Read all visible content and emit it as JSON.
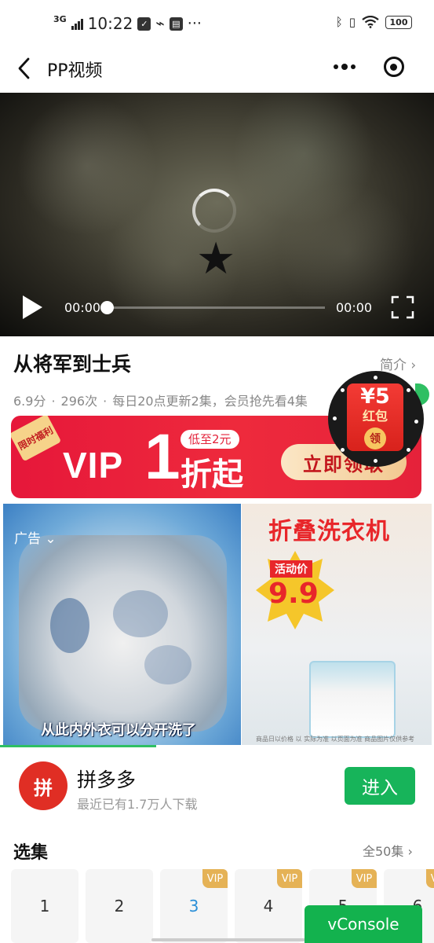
{
  "status_bar": {
    "network": "3G",
    "time": "10:22",
    "battery": "100",
    "more": "···"
  },
  "nav": {
    "title": "PP视频"
  },
  "player": {
    "current_time": "00:00",
    "duration": "00:00",
    "progress": 0
  },
  "video": {
    "title": "从将军到士兵",
    "intro_link": "简介 ›",
    "score": "6.9分",
    "plays": "296次",
    "update_info": "每日20点更新2集，会员抢先看4集"
  },
  "red_packet": {
    "amount": "¥5",
    "label": "红包",
    "grab": "领"
  },
  "vip_banner": {
    "corner": "限时福利",
    "vip_word": "VIP",
    "vip_num": "1",
    "low_price": "低至2元",
    "discount": "折起",
    "cta": "立即领取"
  },
  "ad": {
    "tag": "广告 ⌄",
    "caption": "从此内外衣可以分开洗了",
    "product_title": "折叠洗衣机",
    "activity_price_label": "活动价",
    "price": "9.9",
    "fine_print": "商品日以价格 以 实际为准 以页面为准 商品图片仅供参考",
    "progress": 0.36
  },
  "app": {
    "logo": "拼",
    "name": "拼多多",
    "desc": "最近已有1.7万人下载",
    "enter": "进入"
  },
  "episodes": {
    "title": "选集",
    "all": "全50集 ›",
    "items": [
      {
        "label": "1",
        "vip": ""
      },
      {
        "label": "2",
        "vip": ""
      },
      {
        "label": "3",
        "vip": "VIP"
      },
      {
        "label": "4",
        "vip": "VIP"
      },
      {
        "label": "5",
        "vip": "VIP"
      },
      {
        "label": "6",
        "vip": "VIP"
      }
    ],
    "active_index": 2
  },
  "vconsole": {
    "label": "vConsole"
  }
}
